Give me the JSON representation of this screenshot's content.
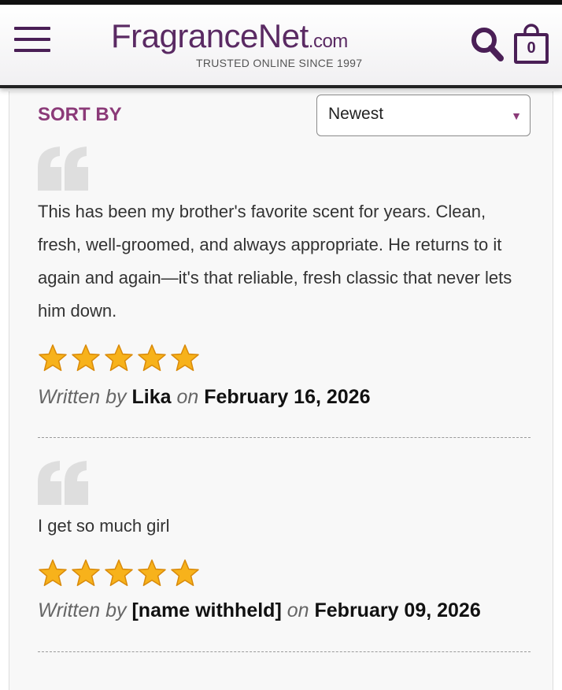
{
  "header": {
    "logo_name": "FragranceNet",
    "logo_suffix": ".com",
    "logo_tagline": "TRUSTED ONLINE SINCE 1997",
    "cart_count": "0",
    "menu_icon": "hamburger-menu-icon",
    "search_icon": "search-icon",
    "cart_icon": "shopping-bag-icon",
    "brand_color": "#5a2a63"
  },
  "sort": {
    "label": "SORT BY",
    "selected": "Newest",
    "accent_color": "#8b3a78"
  },
  "reviews": [
    {
      "text": "This has been my brother's favorite scent for years. Clean, fresh, well-groomed, and always appropriate. He returns to it again and again—it's that reliable, fresh classic that never lets him down.",
      "rating": 5,
      "rating_max": 5,
      "written_by": "Written by",
      "author": "Lika",
      "on": "on",
      "date": "February 16, 2026"
    },
    {
      "text": "I get so much girl",
      "rating": 5,
      "rating_max": 5,
      "written_by": "Written by",
      "author": "[name withheld]",
      "on": "on",
      "date": "February 09, 2026"
    }
  ]
}
